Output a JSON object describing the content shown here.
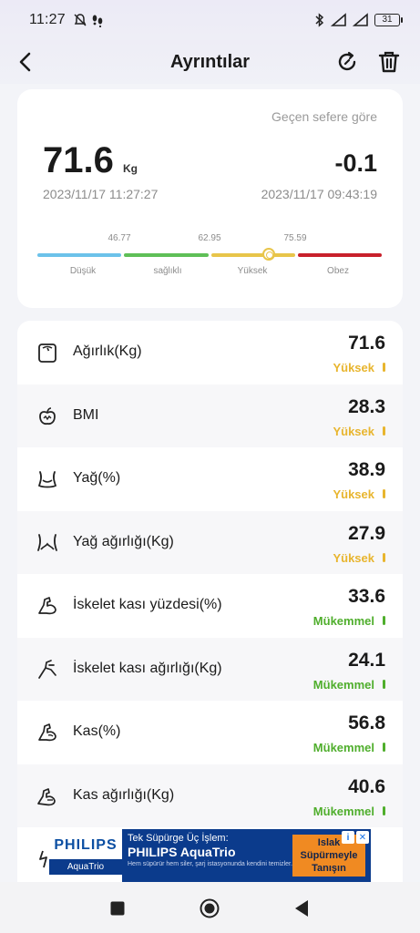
{
  "status_bar": {
    "time": "11:27",
    "battery": "31"
  },
  "header": {
    "title": "Ayrıntılar"
  },
  "summary": {
    "compare_label": "Geçen sefere göre",
    "weight": "71.6",
    "unit": "Kg",
    "difference": "-0.1",
    "current_date": "2023/11/17 11:27:27",
    "previous_date": "2023/11/17 09:43:19",
    "thresholds": [
      "46.77",
      "62.95",
      "75.59"
    ],
    "categories": [
      "Düşük",
      "sağlıklı",
      "Yüksek",
      "Obez"
    ],
    "scale_colors": [
      "#6cc2ea",
      "#5fbf57",
      "#e8c54a",
      "#c8202b"
    ],
    "marker_value": 71.6
  },
  "metrics": [
    {
      "icon": "scale-icon",
      "label": "Ağırlık(Kg)",
      "value": "71.6",
      "status": "Yüksek",
      "color": "#e8b52e"
    },
    {
      "icon": "bmi-icon",
      "label": "BMI",
      "value": "28.3",
      "status": "Yüksek",
      "color": "#e8b52e"
    },
    {
      "icon": "body-fat-icon",
      "label": "Yağ(%)",
      "value": "38.9",
      "status": "Yüksek",
      "color": "#e8b52e"
    },
    {
      "icon": "fat-weight-icon",
      "label": "Yağ ağırlığı(Kg)",
      "value": "27.9",
      "status": "Yüksek",
      "color": "#e8b52e"
    },
    {
      "icon": "muscle-arm-icon",
      "label": "İskelet kası yüzdesi(%)",
      "value": "33.6",
      "status": "Mükemmel",
      "color": "#4fae2c"
    },
    {
      "icon": "skeletal-muscle-icon",
      "label": "İskelet kası ağırlığı(Kg)",
      "value": "24.1",
      "status": "Mükemmel",
      "color": "#4fae2c"
    },
    {
      "icon": "muscle-icon",
      "label": "Kas(%)",
      "value": "56.8",
      "status": "Mükemmel",
      "color": "#4fae2c"
    },
    {
      "icon": "muscle-weight-icon",
      "label": "Kas ağırlığı(Kg)",
      "value": "40.6",
      "status": "Mükemmel",
      "color": "#4fae2c"
    }
  ],
  "ad": {
    "brand": "PHILIPS",
    "product": "AquaTrio",
    "line1": "Tek Süpürge Üç İşlem:",
    "line2": "PHILIPS AquaTrio",
    "line3": "Hem süpürür hem siler, şarj istasyonunda kendini temizler.",
    "cta": "Islak Süpürmeyle Tanışın"
  }
}
